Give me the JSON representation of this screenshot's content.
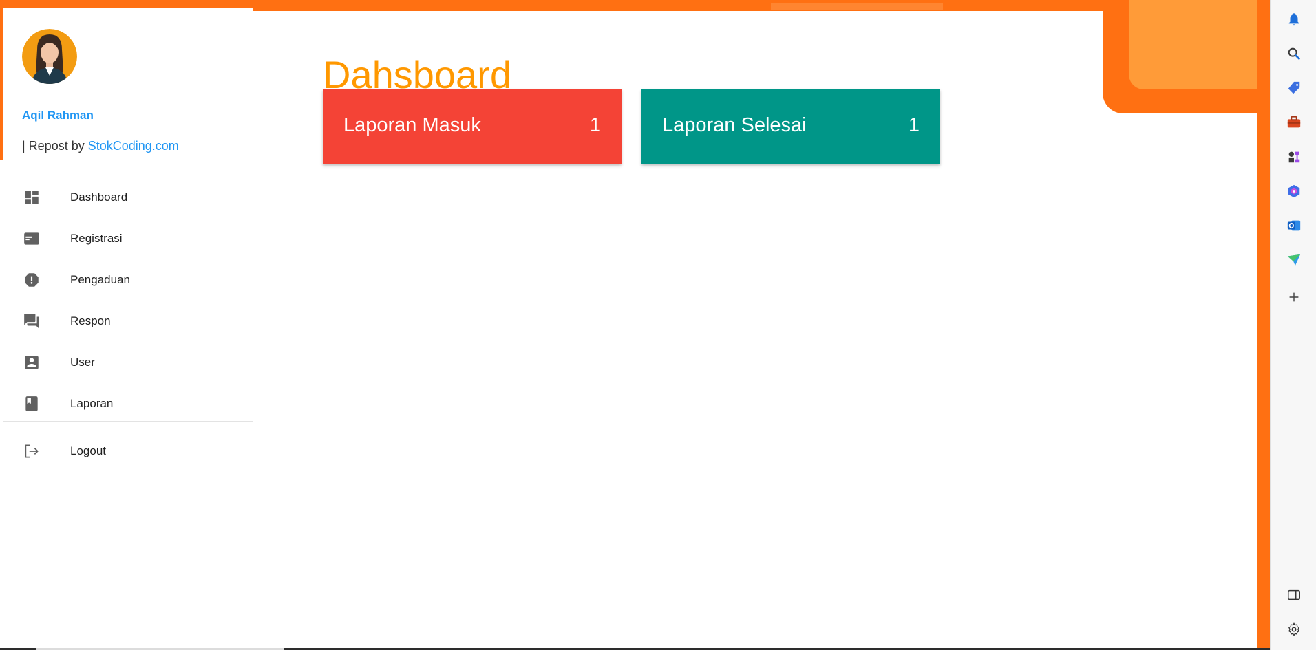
{
  "profile": {
    "name": "Aqil Rahman",
    "repost_prefix": "| Repost by ",
    "repost_link": "StokCoding.com",
    "avatar_icon": "woman-avatar-icon"
  },
  "nav": {
    "items": [
      {
        "label": "Dashboard",
        "icon": "dashboard-icon"
      },
      {
        "label": "Registrasi",
        "icon": "card-icon"
      },
      {
        "label": "Pengaduan",
        "icon": "alert-icon"
      },
      {
        "label": "Respon",
        "icon": "chat-icon"
      },
      {
        "label": "User",
        "icon": "user-icon"
      },
      {
        "label": "Laporan",
        "icon": "book-icon"
      }
    ],
    "logout": {
      "label": "Logout",
      "icon": "logout-icon"
    }
  },
  "main": {
    "title": "Dahsboard",
    "cards": [
      {
        "label": "Laporan Masuk",
        "count": "1",
        "color": "#f44336"
      },
      {
        "label": "Laporan Selesai",
        "count": "1",
        "color": "#009688"
      }
    ]
  },
  "edge_toolbar": {
    "icons": [
      "bell-icon",
      "search-icon",
      "tag-icon",
      "briefcase-icon",
      "chess-icon",
      "copilot-icon",
      "outlook-icon",
      "send-icon",
      "add-icon",
      "sidebar-toggle-icon",
      "settings-icon"
    ]
  },
  "colors": {
    "accent_orange": "#ff7012",
    "title_orange": "#ff9800",
    "link_blue": "#2196f3"
  }
}
